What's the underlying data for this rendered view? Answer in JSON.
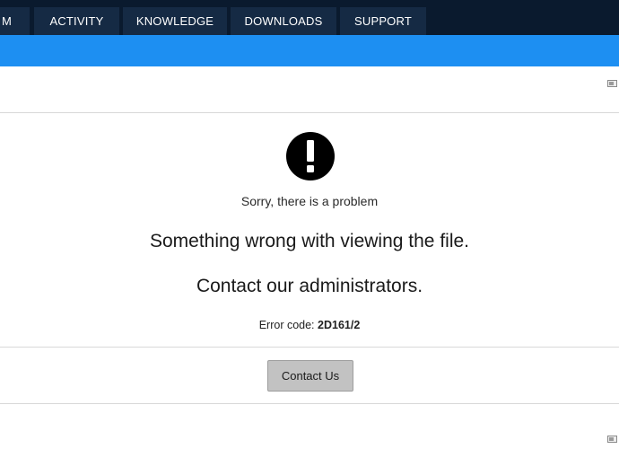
{
  "nav": {
    "tabs": [
      {
        "label": "M"
      },
      {
        "label": "ACTIVITY"
      },
      {
        "label": "KNOWLEDGE"
      },
      {
        "label": "DOWNLOADS"
      },
      {
        "label": "SUPPORT"
      }
    ]
  },
  "message": {
    "icon": "exclamation-circle-icon",
    "sorry": "Sorry, there is a problem",
    "line1": "Something wrong with viewing the file.",
    "line2": "Contact our administrators.",
    "error_label": "Error code:",
    "error_code": "2D161/2"
  },
  "actions": {
    "contact_label": "Contact Us"
  },
  "colors": {
    "nav_bg": "#0a1a2e",
    "nav_tab_bg": "#152a44",
    "accent_bar": "#1d8ff2",
    "button_bg": "#c2c2c2"
  }
}
